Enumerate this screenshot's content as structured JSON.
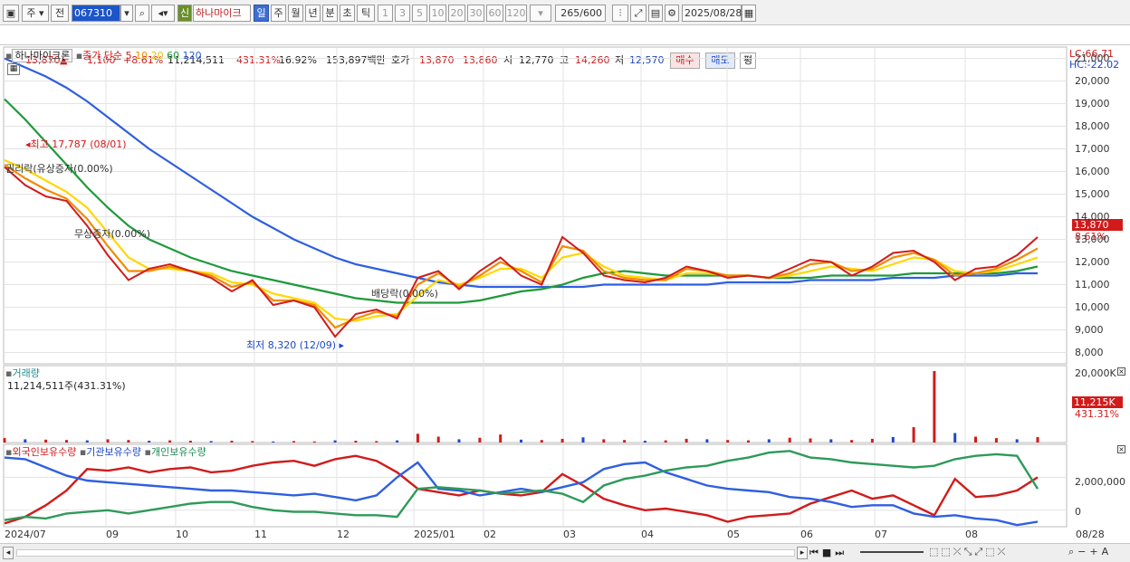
{
  "toolbar": {
    "market": "주",
    "prev": "전",
    "code": "067310",
    "badge": "신",
    "stock_name": "하나마이크",
    "periods": [
      "일",
      "주",
      "월",
      "년",
      "분",
      "초",
      "틱"
    ],
    "intervals": [
      "1",
      "3",
      "5",
      "10",
      "20",
      "30",
      "60",
      "120"
    ],
    "count": "265",
    "count_total": "/600",
    "date": "2025/08/28"
  },
  "quote": {
    "price": "13,870",
    "arrow": "▲",
    "change": "1,100",
    "change_pct": "+8.61%",
    "volume": "11,214,511",
    "volume_ratio": "431.31%",
    "turnover": "16.92%",
    "amount": "153,897백만",
    "bid_label": "호가",
    "bid1": "13,870",
    "bid2": "13,860",
    "open_label": "시",
    "open": "12,770",
    "high_label": "고",
    "high": "14,260",
    "low_label": "저",
    "low": "12,570",
    "buy": "매수",
    "sell": "매도",
    "eval": "평"
  },
  "price_panel": {
    "name": "하나마이크론",
    "ma_label": "종가 단순",
    "ma_periods": [
      "5",
      "10",
      "20",
      "60",
      "120"
    ],
    "ma_colors": [
      "#d11b1b",
      "#f08c00",
      "#ffd800",
      "#1e9a3a",
      "#2f5fe0"
    ],
    "lc": "LC:66.71",
    "hc": "HC:-22.02",
    "high_note": "최고 17,787 (08/01)",
    "low_note": "최저 8,320 (12/09)",
    "event1": "권리락(유상증자(0.00%)",
    "event2": "무상증자(0.00%)",
    "event3": "배당락(0.00%)",
    "last_price": "13,870",
    "last_pct": "8.61%"
  },
  "volume_panel": {
    "name": "거래량",
    "value": "11,214,511주(431.31%)",
    "max_label": "20,000K",
    "last": "11,215K",
    "last_pct": "431.31%"
  },
  "holding_panel": {
    "foreign": "외국인보유수량",
    "institution": "기관보유수량",
    "individual": "개인보유수량",
    "tick_2m": "2,000,000",
    "tick_0": "0"
  },
  "chart_data": [
    {
      "type": "line",
      "title": "하나마이크론",
      "ylim": [
        7500,
        21500
      ],
      "y_ticks": [
        "8,000",
        "9,000",
        "10,000",
        "11,000",
        "12,000",
        "13,000",
        "14,000",
        "15,000",
        "16,000",
        "17,000",
        "18,000",
        "19,000",
        "20,000",
        "21,000"
      ],
      "x_ticks": [
        "2024/07",
        "09",
        "10",
        "11",
        "12",
        "2025/01",
        "02",
        "03",
        "04",
        "05",
        "06",
        "07",
        "08",
        "08/28"
      ],
      "series": [
        {
          "name": "5",
          "values": [
            16200,
            15400,
            14900,
            14700,
            13600,
            12300,
            11200,
            11700,
            11900,
            11600,
            11300,
            10700,
            11200,
            10100,
            10300,
            10000,
            8700,
            9700,
            9900,
            9500,
            11300,
            11600,
            10800,
            11600,
            12200,
            11400,
            11000,
            13100,
            12400,
            11400,
            11200,
            11100,
            11300,
            11800,
            11600,
            11300,
            11400,
            11300,
            11700,
            12100,
            12000,
            11400,
            11800,
            12400,
            12500,
            12000,
            11200,
            11700,
            11800,
            12300,
            13100
          ]
        },
        {
          "name": "10",
          "values": [
            16300,
            15700,
            15200,
            14800,
            13900,
            12700,
            11600,
            11600,
            11800,
            11600,
            11400,
            10900,
            11100,
            10300,
            10300,
            10100,
            9100,
            9500,
            9800,
            9600,
            11000,
            11500,
            10900,
            11400,
            12000,
            11600,
            11100,
            12700,
            12500,
            11600,
            11300,
            11200,
            11200,
            11700,
            11600,
            11400,
            11400,
            11300,
            11500,
            11900,
            12000,
            11600,
            11700,
            12200,
            12400,
            12100,
            11400,
            11500,
            11700,
            12100,
            12600
          ]
        },
        {
          "name": "20",
          "values": [
            16500,
            16100,
            15600,
            15100,
            14400,
            13300,
            12200,
            11700,
            11700,
            11600,
            11500,
            11100,
            11000,
            10600,
            10400,
            10200,
            9500,
            9400,
            9600,
            9700,
            10500,
            11200,
            11000,
            11300,
            11700,
            11700,
            11300,
            12200,
            12400,
            11800,
            11400,
            11300,
            11200,
            11500,
            11500,
            11400,
            11400,
            11300,
            11400,
            11600,
            11800,
            11700,
            11600,
            11900,
            12200,
            12100,
            11600,
            11500,
            11600,
            11900,
            12200
          ]
        },
        {
          "name": "60",
          "values": [
            19200,
            18300,
            17300,
            16300,
            15300,
            14400,
            13600,
            13000,
            12600,
            12200,
            11900,
            11600,
            11400,
            11200,
            11000,
            10800,
            10600,
            10400,
            10300,
            10200,
            10200,
            10200,
            10200,
            10300,
            10500,
            10700,
            10800,
            11000,
            11300,
            11500,
            11600,
            11500,
            11400,
            11400,
            11400,
            11400,
            11400,
            11300,
            11300,
            11300,
            11400,
            11400,
            11400,
            11400,
            11500,
            11500,
            11500,
            11500,
            11500,
            11600,
            11800
          ]
        },
        {
          "name": "120",
          "values": [
            21000,
            20600,
            20200,
            19700,
            19100,
            18400,
            17700,
            17000,
            16400,
            15800,
            15200,
            14600,
            14000,
            13500,
            13000,
            12600,
            12200,
            11900,
            11700,
            11500,
            11300,
            11100,
            11000,
            10900,
            10900,
            10900,
            10900,
            10900,
            10900,
            11000,
            11000,
            11000,
            11000,
            11000,
            11000,
            11100,
            11100,
            11100,
            11100,
            11200,
            11200,
            11200,
            11200,
            11300,
            11300,
            11300,
            11400,
            11400,
            11400,
            11500,
            11500
          ]
        }
      ]
    },
    {
      "type": "bar",
      "title": "거래량",
      "ylim": [
        0,
        20000
      ],
      "values": [
        1200,
        900,
        800,
        700,
        600,
        900,
        700,
        500,
        600,
        500,
        400,
        500,
        400,
        300,
        400,
        300,
        600,
        500,
        400,
        600,
        2400,
        1600,
        900,
        1300,
        2200,
        800,
        700,
        1000,
        1400,
        900,
        700,
        500,
        600,
        1000,
        900,
        700,
        600,
        900,
        1300,
        1100,
        900,
        700,
        1000,
        1500,
        4200,
        19500,
        2600,
        1600,
        1200,
        900,
        1500
      ]
    },
    {
      "type": "line",
      "title": "외국인보유수량 · 기관보유수량 · 개인보유수량",
      "ylim": [
        -1000000,
        4000000
      ],
      "series": [
        {
          "name": "외국인보유수량",
          "values": [
            -800000,
            -400000,
            300000,
            1200000,
            2500000,
            2400000,
            2600000,
            2300000,
            2500000,
            2600000,
            2300000,
            2400000,
            2700000,
            2900000,
            3000000,
            2700000,
            3100000,
            3300000,
            3000000,
            2300000,
            1300000,
            1100000,
            900000,
            1200000,
            1000000,
            900000,
            1100000,
            2200000,
            1500000,
            700000,
            300000,
            0,
            100000,
            -100000,
            -300000,
            -700000,
            -400000,
            -300000,
            -200000,
            400000,
            800000,
            1200000,
            700000,
            900000,
            300000,
            -300000,
            1900000,
            800000,
            900000,
            1200000,
            2000000
          ]
        },
        {
          "name": "기관보유수량",
          "values": [
            3200000,
            3100000,
            2600000,
            2100000,
            1800000,
            1700000,
            1600000,
            1500000,
            1400000,
            1300000,
            1200000,
            1200000,
            1100000,
            1000000,
            900000,
            1000000,
            800000,
            600000,
            900000,
            2000000,
            2900000,
            1300000,
            1200000,
            900000,
            1100000,
            1300000,
            1100000,
            1400000,
            1700000,
            2500000,
            2800000,
            2900000,
            2300000,
            1900000,
            1500000,
            1300000,
            1200000,
            1100000,
            800000,
            700000,
            500000,
            200000,
            300000,
            300000,
            -200000,
            -400000,
            -300000,
            -500000,
            -600000,
            -900000,
            -700000
          ]
        },
        {
          "name": "개인보유수량",
          "values": [
            -600000,
            -400000,
            -500000,
            -200000,
            -100000,
            0,
            -200000,
            0,
            200000,
            400000,
            500000,
            500000,
            200000,
            0,
            -100000,
            -100000,
            -200000,
            -300000,
            -300000,
            -400000,
            1300000,
            1400000,
            1300000,
            1200000,
            1000000,
            1100000,
            1200000,
            1000000,
            500000,
            1500000,
            1900000,
            2100000,
            2400000,
            2600000,
            2700000,
            3000000,
            3200000,
            3500000,
            3600000,
            3200000,
            3100000,
            2900000,
            2800000,
            2700000,
            2600000,
            2700000,
            3100000,
            3300000,
            3400000,
            3300000,
            1300000
          ]
        }
      ]
    }
  ]
}
